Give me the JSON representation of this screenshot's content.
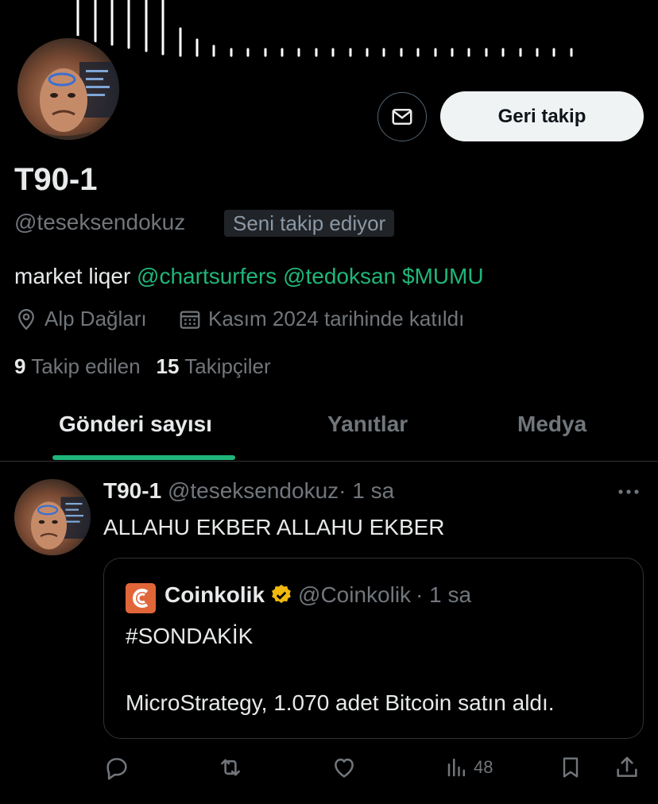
{
  "profile": {
    "name": "T90-1",
    "handle": "@teseksendokuz",
    "follows_you": "Seni takip ediyor",
    "follow_button": "Geri takip",
    "bio_text": "market liqer",
    "bio_links": [
      "@chartsurfers",
      "@tedoksan",
      "$MUMU"
    ],
    "location": "Alp Dağları",
    "joined": "Kasım 2024 tarihinde katıldı",
    "following_count": "9",
    "following_label": "Takip edilen",
    "followers_count": "15",
    "followers_label": "Takipçiler"
  },
  "tabs": [
    {
      "label": "Gönderi sayısı",
      "active": true
    },
    {
      "label": "Yanıtlar",
      "active": false
    },
    {
      "label": "Medya",
      "active": false
    }
  ],
  "post": {
    "author_name": "T90-1",
    "author_handle": "@teseksendokuz",
    "time": "· 1 sa",
    "text": "ALLAHU EKBER ALLAHU EKBER",
    "quote": {
      "author_name": "Coinkolik",
      "author_handle": "@Coinkolik",
      "time": "· 1 sa",
      "line1": "#SONDAKİK",
      "line2": "MicroStrategy, 1.070 adet Bitcoin satın aldı."
    },
    "actions": {
      "reply_icon": "reply-icon",
      "repost_icon": "repost-icon",
      "like_icon": "like-icon",
      "views_icon": "views-icon",
      "views_count": "48",
      "bookmark_icon": "bookmark-icon",
      "share_icon": "share-icon"
    }
  },
  "colors": {
    "accent": "#1fb67a",
    "background": "#000000",
    "muted": "#71767b",
    "coinkolik_brand": "#e0663a",
    "verified_gold": "#f0b90b"
  }
}
